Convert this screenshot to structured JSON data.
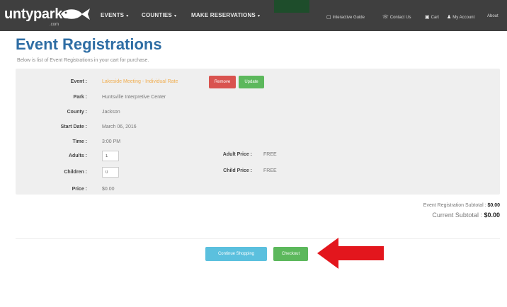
{
  "nav": {
    "logo_text": "untyparks",
    "logo_sub": ".com",
    "menu": [
      "EVENTS",
      "COUNTIES",
      "MAKE RESERVATIONS"
    ],
    "utility": [
      {
        "icon": "calendar-icon",
        "label": "Interactive Guide"
      },
      {
        "icon": "phone-icon",
        "label": "Contact Us"
      },
      {
        "icon": "cart-icon",
        "label": "Cart"
      },
      {
        "icon": "user-icon",
        "label": "My Account"
      },
      {
        "icon": "",
        "label": "About"
      }
    ],
    "colors": {
      "bar": "#3f3f3f",
      "green_tab": "#1e4d2b"
    }
  },
  "header": {
    "title": "Event Registrations",
    "subtitle": "Below is list of Event Registrations in your cart for purchase."
  },
  "registration": {
    "labels": {
      "event": "Event :",
      "park": "Park :",
      "county": "County :",
      "start_date": "Start Date :",
      "time": "Time :",
      "adults": "Adults :",
      "children": "Children :",
      "price": "Price :",
      "adult_price": "Adult Price :",
      "child_price": "Child Price :"
    },
    "event": "Lakeside Meeting - Individual Rate",
    "park": "Huntsville Interpretive Center",
    "county": "Jackson",
    "start_date": "March 06, 2016",
    "time": "3:00 PM",
    "adults": "1",
    "children": "0",
    "price": "$0.00",
    "adult_price": "FREE",
    "child_price": "FREE",
    "remove_label": "Remove",
    "update_label": "Update"
  },
  "totals": {
    "event_subtotal_label": "Event Registration Subtotal :",
    "event_subtotal": "$0.00",
    "current_subtotal_label": "Current Subtotal :",
    "current_subtotal": "$0.00"
  },
  "actions": {
    "continue_label": "Continue Shopping",
    "checkout_label": "Checkout"
  },
  "colors": {
    "title": "#2e6da4",
    "event_link": "#f0ad4e",
    "remove": "#d9534f",
    "update": "#5cb85c",
    "continue": "#5bc0de",
    "checkout": "#5cb85c",
    "arrow": "#e3161d"
  }
}
